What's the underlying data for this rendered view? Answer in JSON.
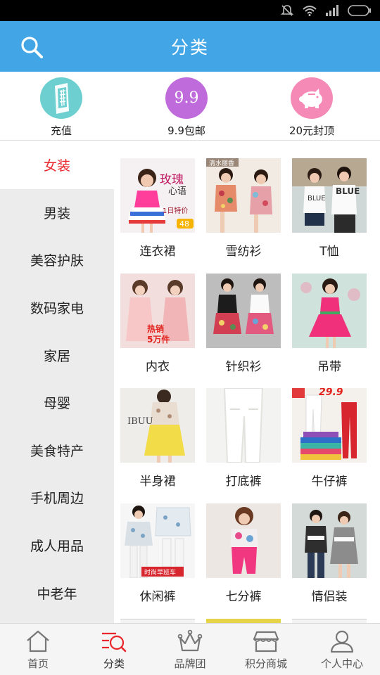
{
  "header": {
    "title": "分类"
  },
  "quick_links": [
    {
      "label": "充值",
      "color": "#6dcfcf"
    },
    {
      "label": "9.9包邮",
      "color": "#c06bdc",
      "badge": "9.9"
    },
    {
      "label": "20元封顶",
      "color": "#f58ab7"
    }
  ],
  "sidebar": {
    "items": [
      {
        "label": "女装",
        "active": true
      },
      {
        "label": "男装"
      },
      {
        "label": "美容护肤"
      },
      {
        "label": "数码家电"
      },
      {
        "label": "家居"
      },
      {
        "label": "母婴"
      },
      {
        "label": "美食特产"
      },
      {
        "label": "手机周边"
      },
      {
        "label": "成人用品"
      },
      {
        "label": "中老年"
      }
    ]
  },
  "products": [
    {
      "label": "连衣裙",
      "overlay": [
        "玫瑰",
        "心语",
        "1日特价",
        "48"
      ]
    },
    {
      "label": "雪纺衫",
      "overlay": [
        "清水丽香"
      ]
    },
    {
      "label": "T恤",
      "overlay": [
        "BLUE",
        "BLUE"
      ]
    },
    {
      "label": "内衣",
      "overlay": [
        "热销",
        "5万件"
      ]
    },
    {
      "label": "针织衫",
      "overlay": []
    },
    {
      "label": "吊带",
      "overlay": []
    },
    {
      "label": "半身裙",
      "overlay": [
        "IBUU"
      ]
    },
    {
      "label": "打底裤",
      "overlay": []
    },
    {
      "label": "牛仔裤",
      "overlay": [
        "29.9"
      ]
    },
    {
      "label": "休闲裤",
      "overlay": [
        "时尚早班车"
      ]
    },
    {
      "label": "七分裤",
      "overlay": []
    },
    {
      "label": "情侣装",
      "overlay": []
    }
  ],
  "tabs": [
    {
      "label": "首页",
      "icon": "home-icon"
    },
    {
      "label": "分类",
      "icon": "category-search-icon",
      "active": true
    },
    {
      "label": "品牌团",
      "icon": "crown-icon"
    },
    {
      "label": "积分商城",
      "icon": "store-icon"
    },
    {
      "label": "个人中心",
      "icon": "person-icon"
    }
  ],
  "colors": {
    "header": "#42a6e6",
    "active_text": "#e8262b",
    "tab_active": "#e8262b"
  }
}
